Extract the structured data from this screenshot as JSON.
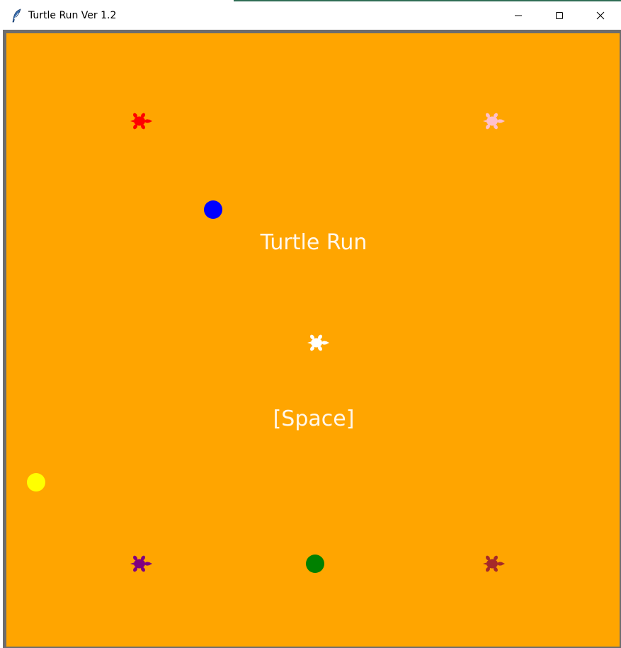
{
  "window": {
    "title": "Turtle Run Ver 1.2",
    "icon": "feather-icon",
    "controls": [
      "minimize-icon",
      "maximize-icon",
      "close-icon"
    ]
  },
  "game": {
    "background_color": "#ffa500",
    "title_text": "Turtle Run",
    "prompt_text": "[Space]",
    "turtles": [
      {
        "color": "#ff0000",
        "name": "red"
      },
      {
        "color": "#ffc0cb",
        "name": "pink"
      },
      {
        "color": "#ffffff",
        "name": "white"
      },
      {
        "color": "#800080",
        "name": "purple"
      },
      {
        "color": "#a52a2a",
        "name": "brown"
      }
    ],
    "dots": [
      {
        "color": "#0000ff",
        "name": "blue"
      },
      {
        "color": "#ffff00",
        "name": "yellow"
      },
      {
        "color": "#008000",
        "name": "green"
      }
    ]
  }
}
